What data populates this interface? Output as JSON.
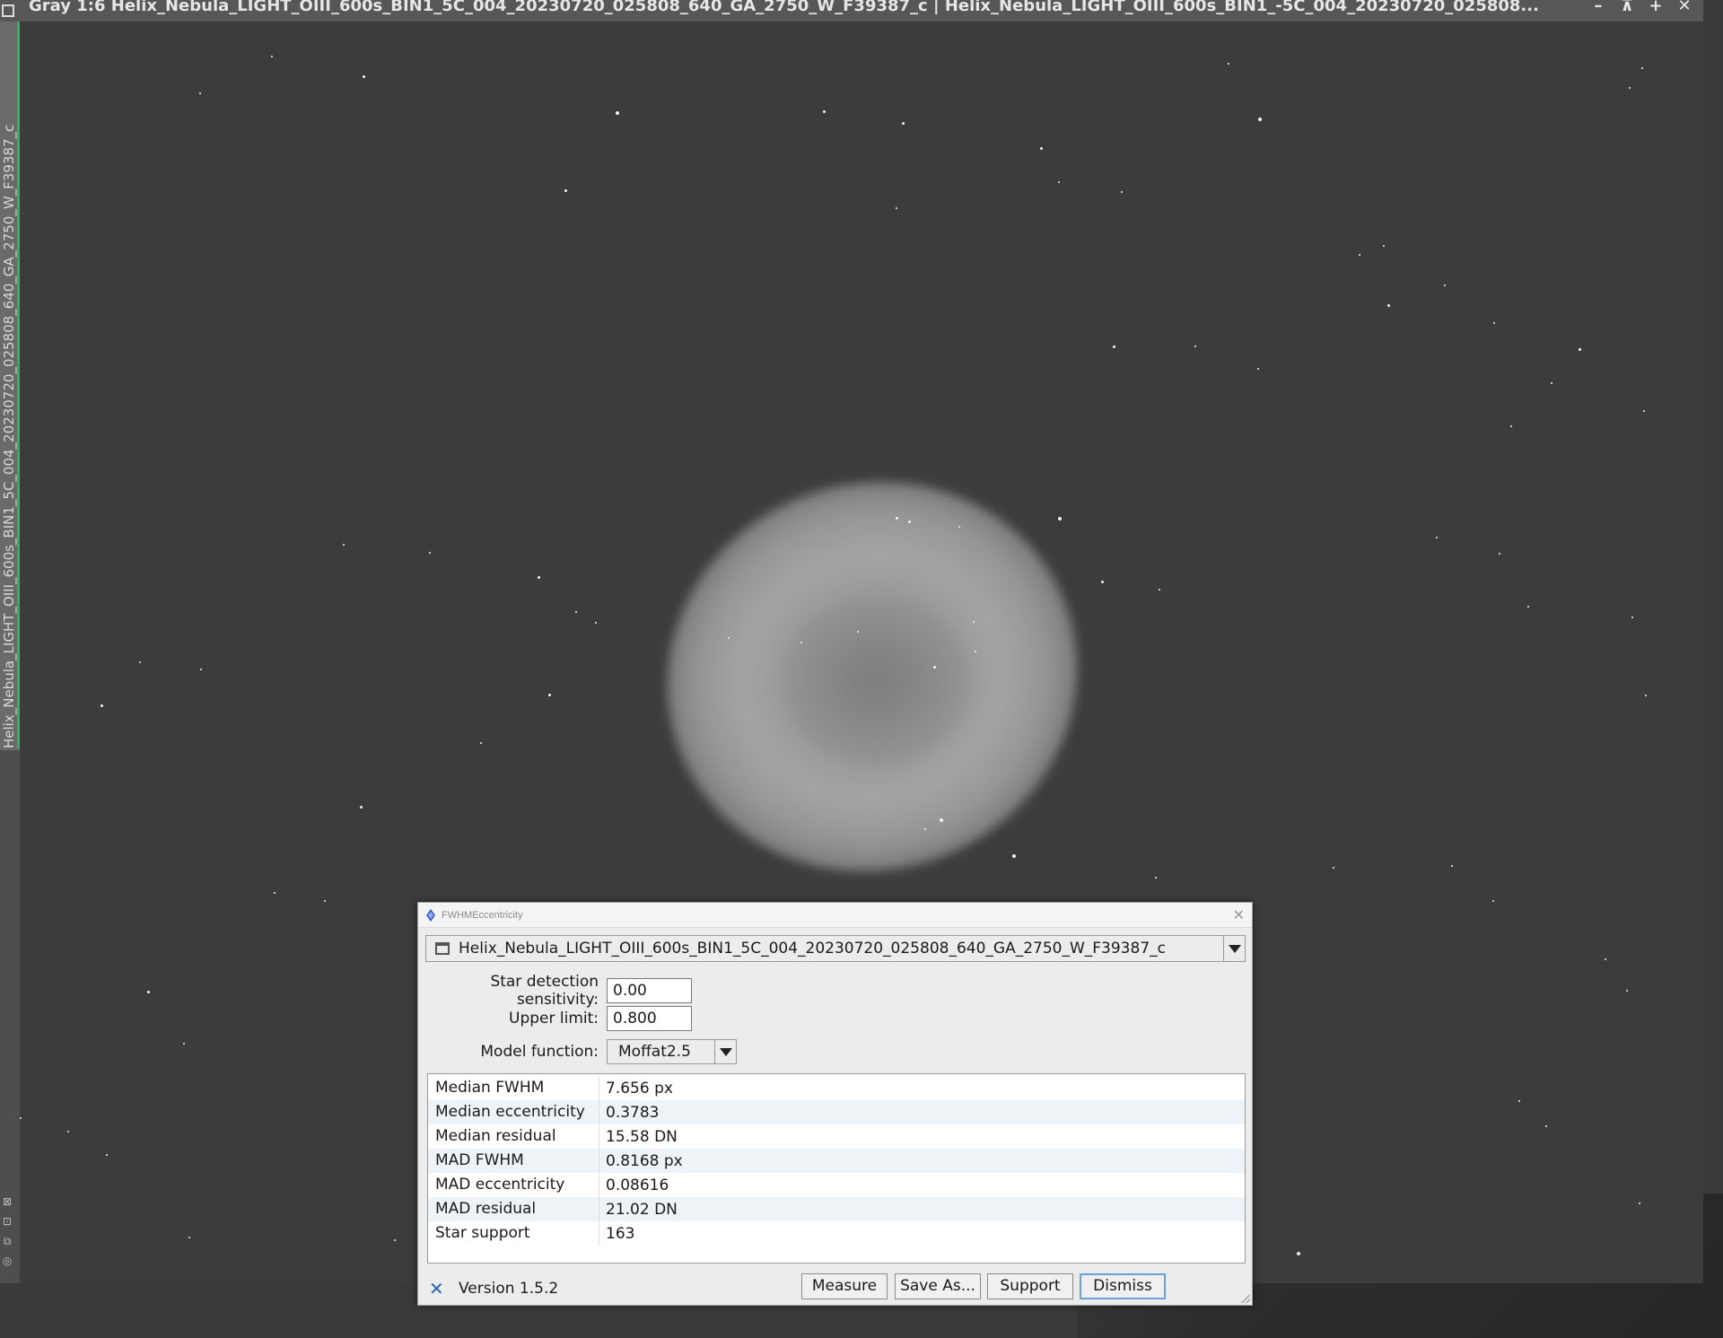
{
  "image_window": {
    "title": "Gray 1:6 Helix_Nebula_LIGHT_OIII_600s_BIN1_5C_004_20230720_025808_640_GA_2750_W_F39387_c | Helix_Nebula_LIGHT_OIII_600s_BIN1_-5C_004_20230720_025808...",
    "side_tab_label": "Helix_Nebula_LIGHT_OIII_600s_BIN1_5C_004_20230720_025808_640_GA_2750_W_F39387_c",
    "buttons": [
      "minimize",
      "shade",
      "maximize",
      "close"
    ],
    "button_glyphs": [
      "–",
      "⊼",
      "+",
      "✕"
    ]
  },
  "dialog": {
    "title": "FWHMEccentricity",
    "view": "Helix_Nebula_LIGHT_OIII_600s_BIN1_5C_004_20230720_025808_640_GA_2750_W_F39387_c",
    "star_detection_label": "Star detection sensitivity:",
    "star_detection_value": "0.00",
    "upper_limit_label": "Upper limit:",
    "upper_limit_value": "0.800",
    "model_function_label": "Model function:",
    "model_function_value": "Moffat2.5",
    "results": [
      {
        "key": "Median FWHM",
        "value": "7.656 px"
      },
      {
        "key": "Median eccentricity",
        "value": "0.3783"
      },
      {
        "key": "Median residual",
        "value": "15.58 DN"
      },
      {
        "key": "MAD FWHM",
        "value": "0.8168 px"
      },
      {
        "key": "MAD eccentricity",
        "value": "0.08616"
      },
      {
        "key": "MAD residual",
        "value": "21.02 DN"
      },
      {
        "key": "Star support",
        "value": "163"
      }
    ],
    "version": "Version 1.5.2",
    "buttons": {
      "measure": "Measure",
      "save_as": "Save As...",
      "support": "Support",
      "dismiss": "Dismiss"
    }
  },
  "colors": {
    "active_tab_accent": "#28b463",
    "dialog_background": "#ececec",
    "canvas_background": "#3c3c3c"
  }
}
